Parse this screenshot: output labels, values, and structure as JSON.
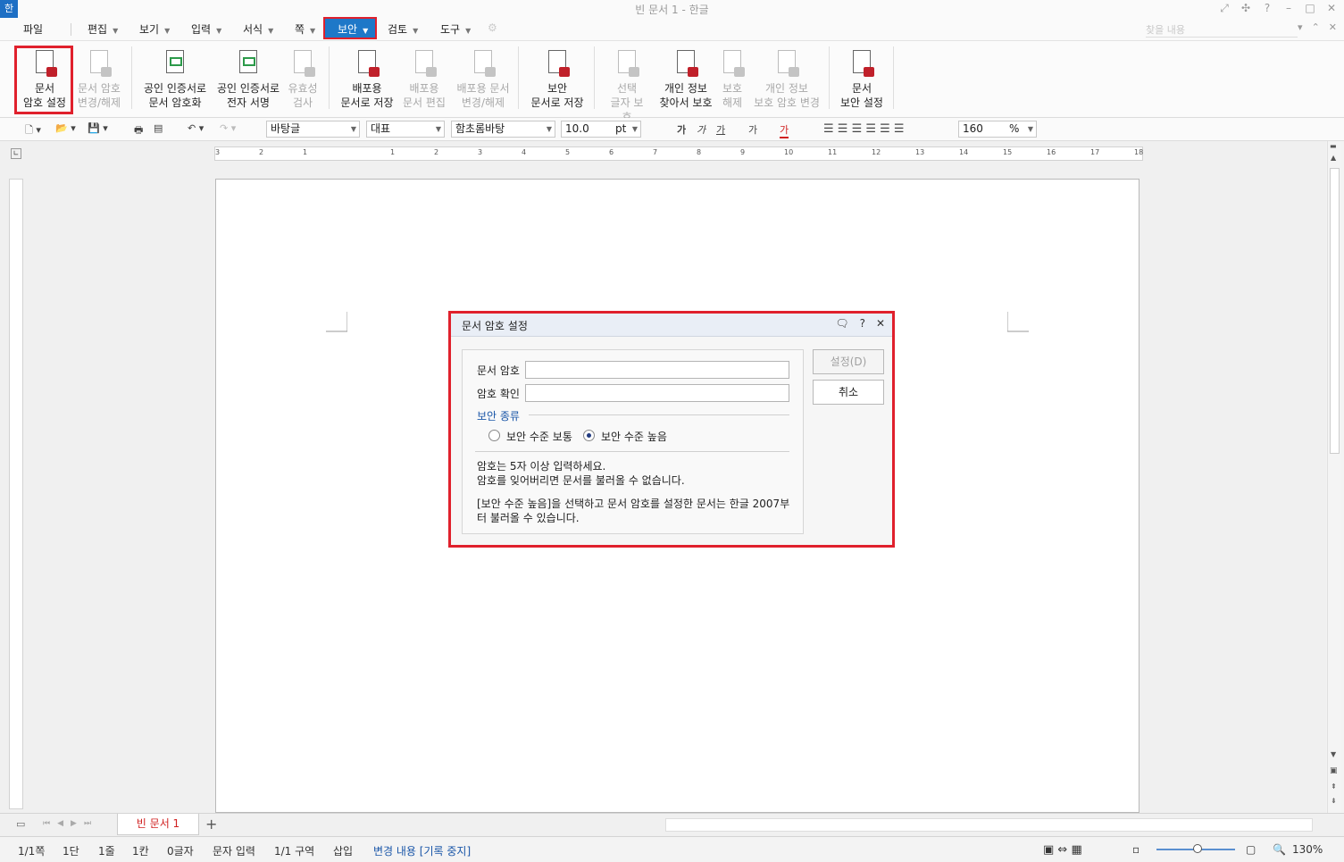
{
  "window": {
    "title": "빈 문서 1 - 한글",
    "logo": "한"
  },
  "menu": {
    "file": "파일",
    "items": [
      "편집",
      "보기",
      "입력",
      "서식",
      "쪽",
      "보안",
      "검토",
      "도구"
    ],
    "search_placeholder": "찾을 내용"
  },
  "ribbon": {
    "buttons": [
      {
        "label1": "문서",
        "label2": "암호 설정",
        "icon": "doc-password-icon"
      },
      {
        "label1": "문서 암호",
        "label2": "변경/해제",
        "icon": "doc-password-change-icon"
      },
      {
        "label1": "공인 인증서로",
        "label2": "문서 암호화",
        "icon": "cert-encrypt-icon"
      },
      {
        "label1": "공인 인증서로",
        "label2": "전자 서명",
        "icon": "cert-sign-icon"
      },
      {
        "label1": "유효성",
        "label2": "검사",
        "icon": "validity-check-icon"
      },
      {
        "label1": "배포용",
        "label2": "문서로 저장",
        "icon": "distribution-save-icon"
      },
      {
        "label1": "배포용",
        "label2": "문서 편집",
        "icon": "distribution-edit-icon"
      },
      {
        "label1": "배포용 문서",
        "label2": "변경/해제",
        "icon": "distribution-change-icon"
      },
      {
        "label1": "보안",
        "label2": "문서로 저장",
        "icon": "secure-save-icon"
      },
      {
        "label1": "선택",
        "label2": "글자 보호",
        "icon": "text-protect-icon"
      },
      {
        "label1": "개인 정보",
        "label2": "찾아서 보호",
        "icon": "privacy-find-icon"
      },
      {
        "label1": "보호",
        "label2": "해제",
        "icon": "unprotect-icon"
      },
      {
        "label1": "개인 정보",
        "label2": "보호 암호 변경",
        "icon": "privacy-password-icon"
      },
      {
        "label1": "문서",
        "label2": "보안 설정",
        "icon": "doc-security-icon"
      }
    ]
  },
  "toolbar": {
    "style": "바탕글",
    "font_lang": "대표",
    "font": "함초롬바탕",
    "size": "10.0",
    "unit": "pt",
    "format_chars": [
      "가",
      "가",
      "가",
      "가",
      "가"
    ],
    "line_spacing": "160",
    "line_unit": "%"
  },
  "ruler": {
    "numbers": [
      "3",
      "2",
      "1",
      "",
      "1",
      "2",
      "3",
      "4",
      "5",
      "6",
      "7",
      "8",
      "9",
      "10",
      "11",
      "12",
      "13",
      "14",
      "15",
      "16",
      "17",
      "18"
    ]
  },
  "dialog": {
    "title": "문서 암호 설정",
    "password_label": "문서 암호",
    "password_value": "",
    "confirm_label": "암호 확인",
    "confirm_value": "",
    "security_type_label": "보안 종류",
    "radio_normal": "보안 수준 보통",
    "radio_high": "보안 수준 높음",
    "selected": "high",
    "note1": "암호는 5자 이상 입력하세요.",
    "note2": "암호를 잊어버리면 문서를 불러올 수 없습니다.",
    "note3": "[보안 수준 높음]을 선택하고 문서 암호를 설정한 문서는 한글 2007부",
    "note4": "터 불러올 수 있습니다.",
    "set_button": "설정(D)",
    "cancel_button": "취소"
  },
  "tabs": {
    "doc_tab": "빈 문서 1",
    "add": "+"
  },
  "status": {
    "page": "1/1쪽",
    "column": "1단",
    "line": "1줄",
    "col_pos": "1칸",
    "chars": "0글자",
    "mode": "문자 입력",
    "section": "1/1 구역",
    "insert": "삽입",
    "track": "변경 내용 [기록 중지]",
    "zoom": "130%"
  },
  "colors": {
    "accent": "#1e78c8",
    "highlight": "#e0202c"
  }
}
